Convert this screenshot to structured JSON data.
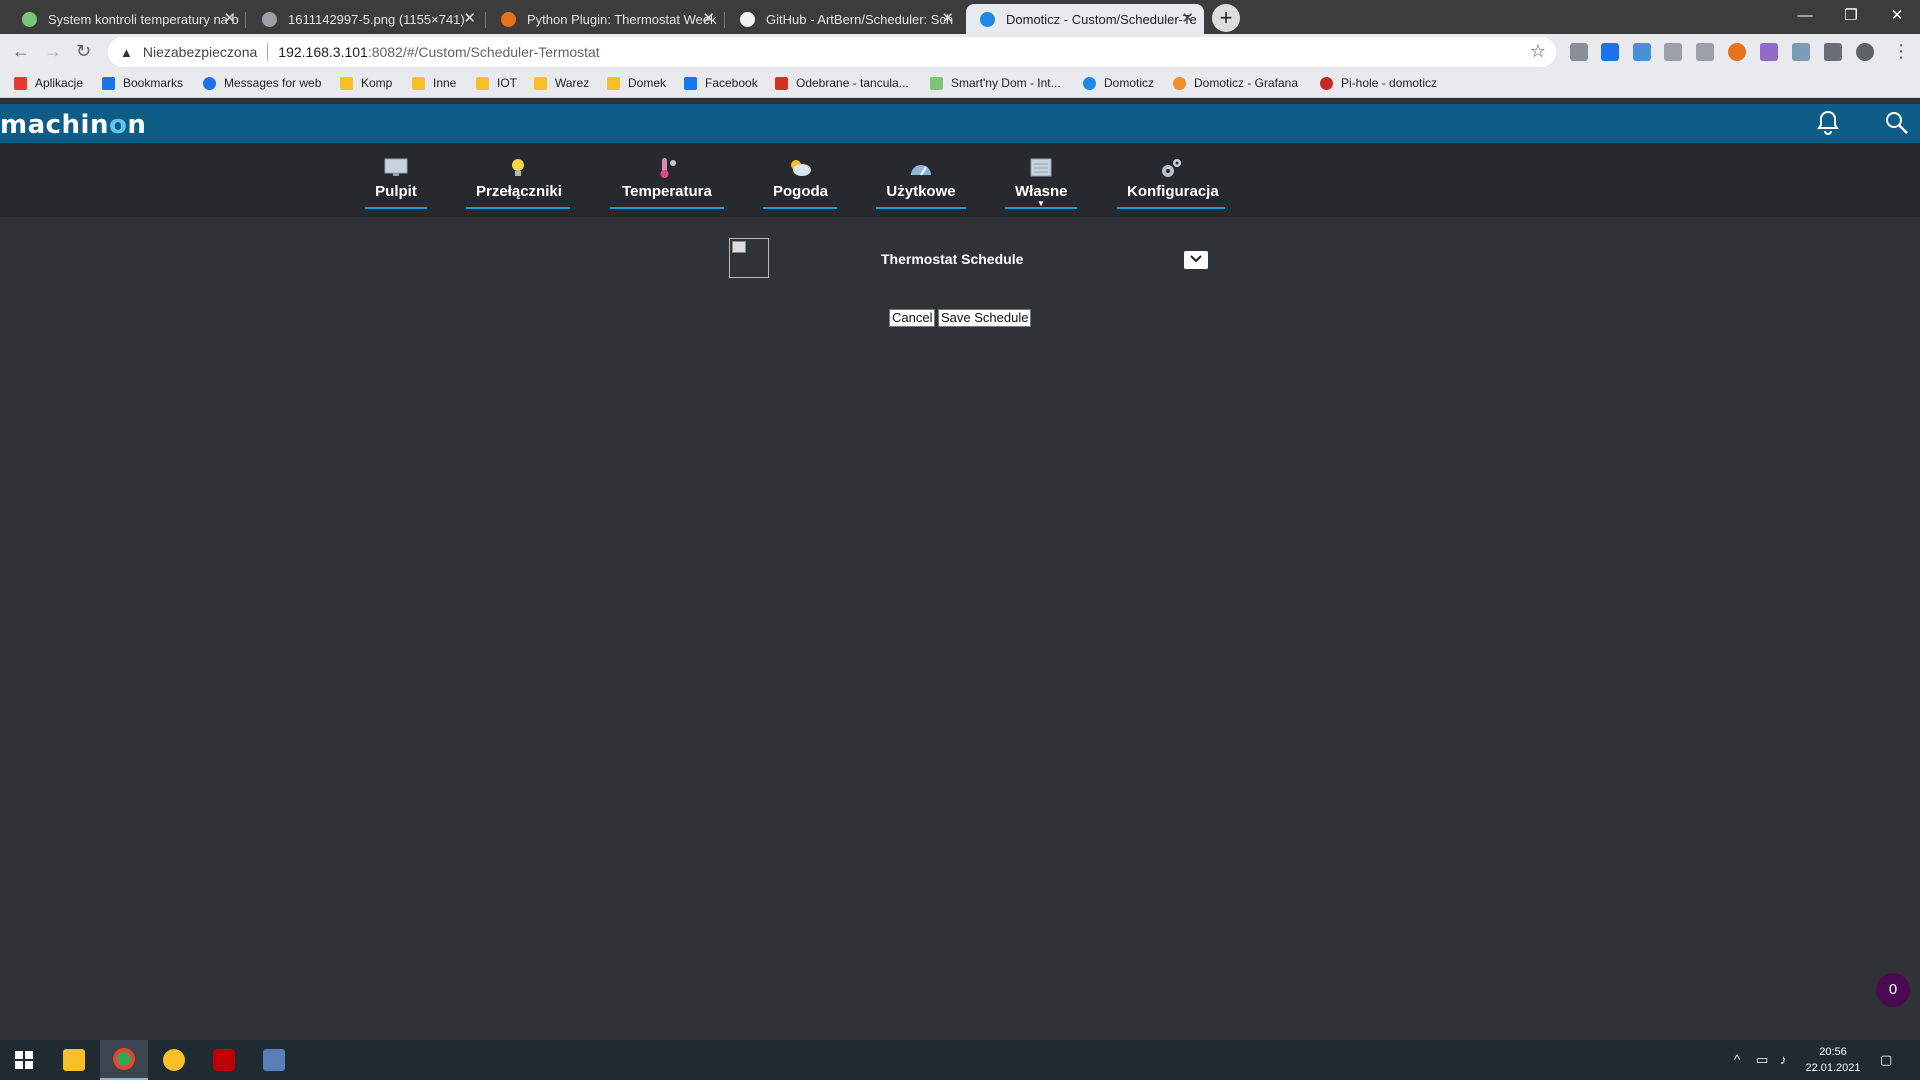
{
  "browser": {
    "tabs": [
      {
        "title": "System kontroli temperatury na b",
        "favicon_color": "#7cc576"
      },
      {
        "title": "1611142997-5.png (1155×741)",
        "favicon_color": "#9aa0a6"
      },
      {
        "title": "Python Plugin: Thermostat Week",
        "favicon_color": "#e8711b"
      },
      {
        "title": "GitHub - ArtBern/Scheduler: Sch",
        "favicon_color": "#f1f1f1"
      },
      {
        "title": "Domoticz - Custom/Scheduler-Te",
        "favicon_color": "#1e88e5"
      }
    ],
    "active_tab": 4,
    "address": {
      "security_label": "Niezabezpieczona",
      "host": "192.168.3.101",
      "path": ":8082/#/Custom/Scheduler-Termostat"
    },
    "bookmarks": [
      {
        "label": "Aplikacje",
        "color": "#e53935"
      },
      {
        "label": "Bookmarks",
        "color": "#1a73e8"
      },
      {
        "label": "Messages for web",
        "color": "#1a73e8"
      },
      {
        "label": "Komp",
        "color": "#f6c026"
      },
      {
        "label": "Inne",
        "color": "#f6c026"
      },
      {
        "label": "IOT",
        "color": "#f6c026"
      },
      {
        "label": "Warez",
        "color": "#f6c026"
      },
      {
        "label": "Domek",
        "color": "#f6c026"
      },
      {
        "label": "Facebook",
        "color": "#1877f2"
      },
      {
        "label": "Odebrane - tancula...",
        "color": "#d93025"
      },
      {
        "label": "Smart'ny Dom - Int...",
        "color": "#7cc576"
      },
      {
        "label": "Domoticz",
        "color": "#1e88e5"
      },
      {
        "label": "Domoticz - Grafana",
        "color": "#f28c28"
      },
      {
        "label": "Pi-hole - domoticz",
        "color": "#c62828"
      }
    ]
  },
  "app": {
    "logo_prefix": "machin",
    "logo_o": "o",
    "logo_suffix": "n",
    "nav": [
      {
        "label": "Pulpit",
        "icon": "monitor-icon"
      },
      {
        "label": "Przełączniki",
        "icon": "lightbulb-icon"
      },
      {
        "label": "Temperatura",
        "icon": "thermometer-icon"
      },
      {
        "label": "Pogoda",
        "icon": "weather-icon"
      },
      {
        "label": "Użytkowe",
        "icon": "gauge-icon"
      },
      {
        "label": "Własne",
        "icon": "custom-page-icon"
      },
      {
        "label": "Konfiguracja",
        "icon": "gears-icon"
      }
    ],
    "content": {
      "title": "Thermostat Schedule",
      "cancel_label": "Cancel",
      "save_label": "Save Schedule"
    },
    "notification_count": "0"
  },
  "taskbar": {
    "time": "20:56",
    "date": "22.01.2021"
  }
}
